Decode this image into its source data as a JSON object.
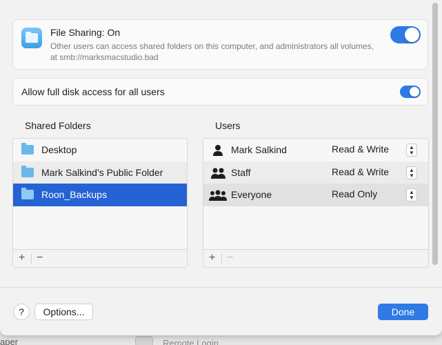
{
  "background": {
    "bottom_left_text": "aper",
    "bottom_item_label": "Remote Login"
  },
  "sharing": {
    "title": "File Sharing: On",
    "description": "Other users can access shared folders on this computer, and administrators all volumes, at smb://marksmacstudio.bad",
    "enabled": true
  },
  "disk_access": {
    "label": "Allow full disk access for all users",
    "enabled": true
  },
  "shared_folders": {
    "title": "Shared Folders",
    "items": [
      {
        "label": "Desktop",
        "selected": false
      },
      {
        "label": "Mark Salkind’s Public Folder",
        "selected": false
      },
      {
        "label": "Roon_Backups",
        "selected": true
      }
    ],
    "add_label": "+",
    "remove_label": "−"
  },
  "users": {
    "title": "Users",
    "items": [
      {
        "name": "Mark Salkind",
        "permission": "Read & Write",
        "icon": "person-icon"
      },
      {
        "name": "Staff",
        "permission": "Read & Write",
        "icon": "group-icon"
      },
      {
        "name": "Everyone",
        "permission": "Read Only",
        "icon": "everyone-icon"
      }
    ],
    "add_label": "+",
    "remove_label": "−"
  },
  "footer": {
    "help_label": "?",
    "options_label": "Options...",
    "done_label": "Done"
  },
  "colors": {
    "accent": "#2f7ae5",
    "selection": "#2563d4"
  }
}
